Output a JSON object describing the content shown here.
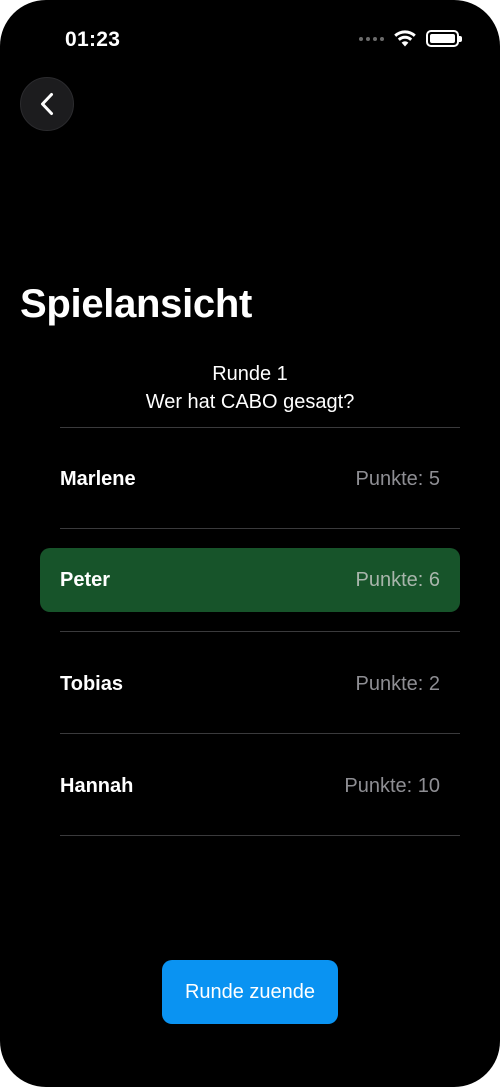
{
  "status_bar": {
    "time": "01:23"
  },
  "navigation": {
    "back_icon": "chevron-left-icon"
  },
  "page": {
    "title": "Spielansicht",
    "round_label": "Runde 1",
    "question": "Wer hat CABO gesagt?"
  },
  "players": [
    {
      "name": "Marlene",
      "points": "Punkte: 5",
      "selected": false
    },
    {
      "name": "Peter",
      "points": "Punkte: 6",
      "selected": true
    },
    {
      "name": "Tobias",
      "points": "Punkte: 2",
      "selected": false
    },
    {
      "name": "Hannah",
      "points": "Punkte: 10",
      "selected": false
    }
  ],
  "actions": {
    "end_round_label": "Runde zuende"
  },
  "colors": {
    "background": "#000000",
    "selected_row": "#17542a",
    "primary_button": "#0a93f2",
    "secondary_text": "#8e8e93"
  }
}
